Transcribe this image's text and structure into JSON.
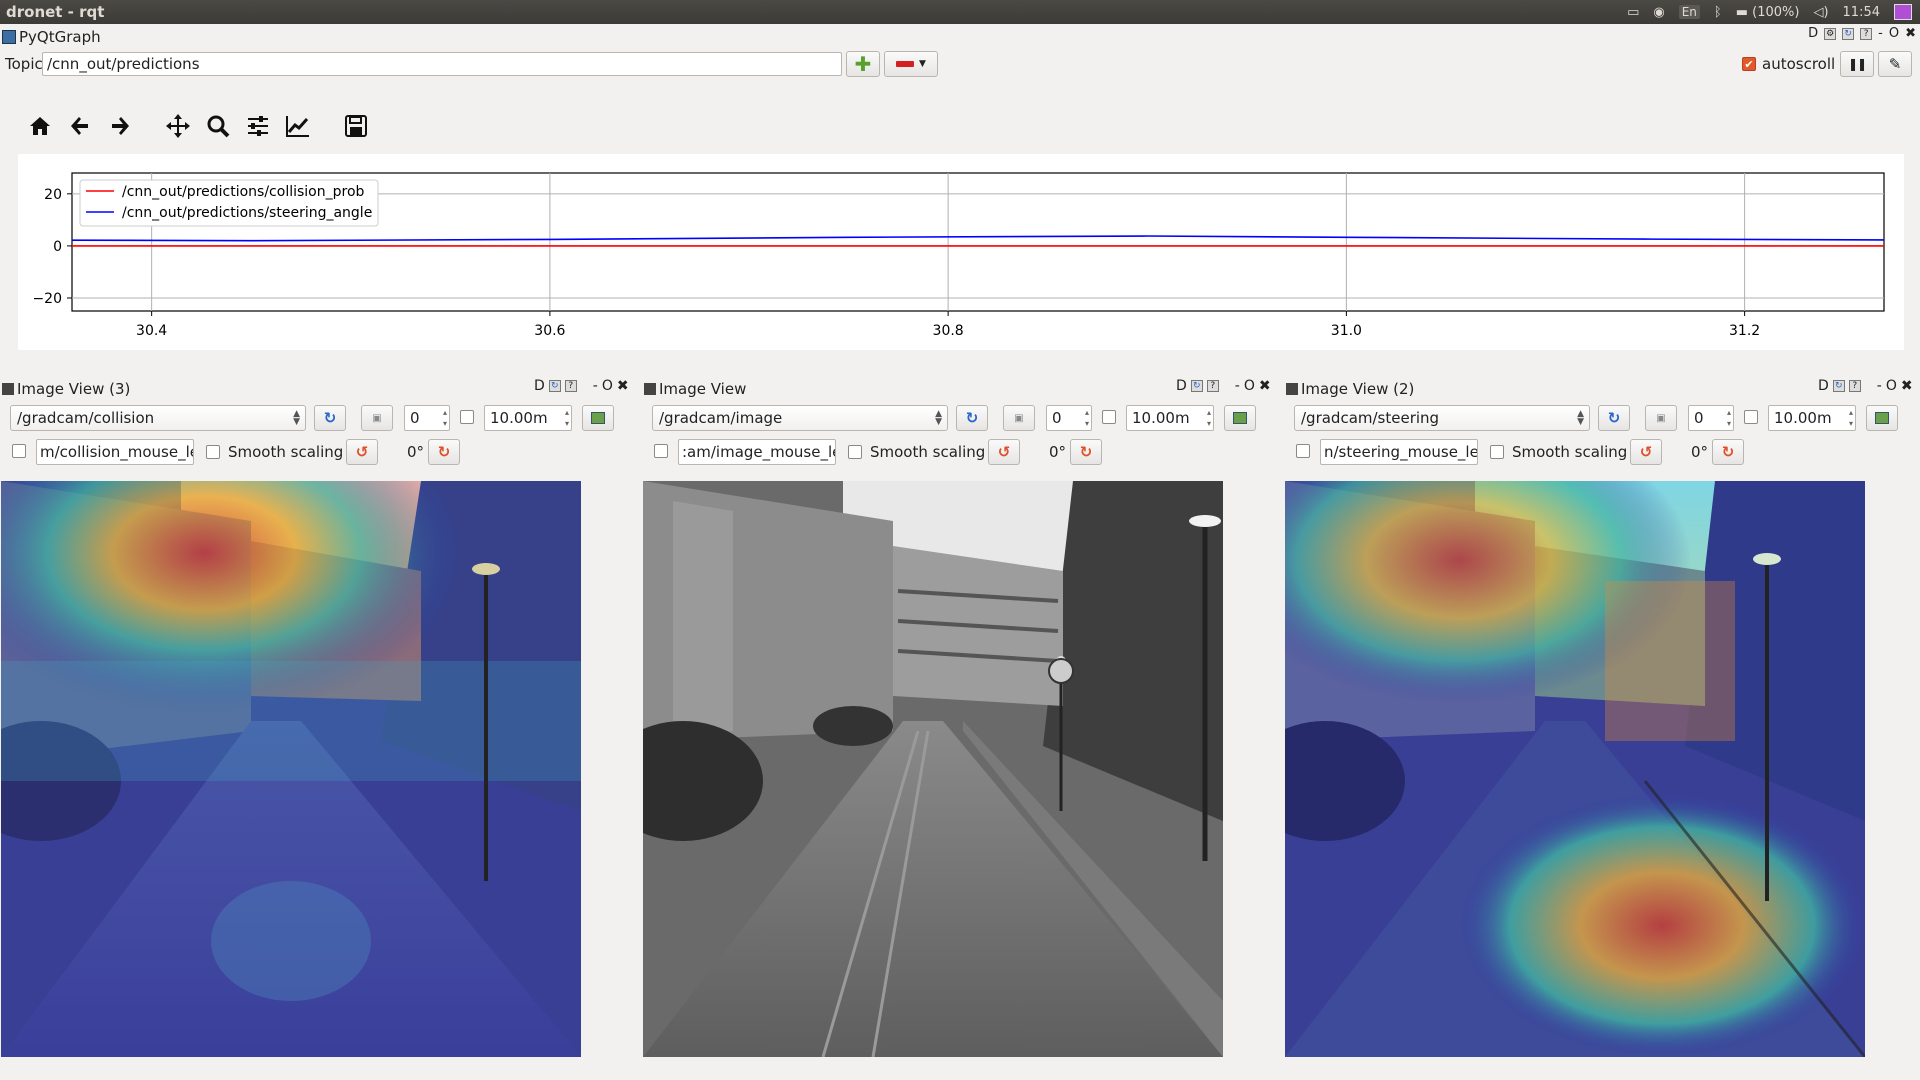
{
  "system_bar": {
    "title": "dronet - rqt",
    "lang": "En",
    "battery": "(100%)",
    "time": "11:54"
  },
  "plugin": {
    "title": "PyQtGraph",
    "ctrl_d": "D",
    "ctrl_dash": "-",
    "ctrl_o": "O",
    "ctrl_x": "✖"
  },
  "topic": {
    "label": "Topic",
    "value": "/cnn_out/predictions",
    "autoscroll_label": "autoscroll",
    "autoscroll_checked": true
  },
  "toolbar": {
    "icons": [
      "home-icon",
      "back-arrow-icon",
      "forward-arrow-icon",
      "pan-icon",
      "zoom-icon",
      "configure-subplots-icon",
      "edit-axis-icon",
      "save-icon"
    ]
  },
  "chart_data": {
    "type": "line",
    "x": [
      30.36,
      30.45,
      30.6,
      30.75,
      30.9,
      31.0,
      31.15,
      31.27
    ],
    "series": [
      {
        "name": "/cnn_out/predictions/collision_prob",
        "color": "#ff0000",
        "values": [
          0.0,
          0.0,
          0.0,
          0.0,
          0.0,
          0.0,
          0.0,
          0.0
        ]
      },
      {
        "name": "/cnn_out/predictions/steering_angle",
        "color": "#0000ff",
        "values": [
          2.2,
          2.0,
          2.5,
          3.3,
          3.8,
          3.3,
          2.6,
          2.3
        ]
      }
    ],
    "xlim": [
      30.36,
      31.27
    ],
    "ylim": [
      -25,
      28
    ],
    "xticks": [
      "30.4",
      "30.6",
      "30.8",
      "31.0",
      "31.2"
    ],
    "yticks": [
      "20",
      "0",
      "−20"
    ],
    "xtick_values": [
      30.4,
      30.6,
      30.8,
      31.0,
      31.2
    ],
    "ytick_values": [
      20,
      0,
      -20
    ],
    "grid": true,
    "legend": "top-left"
  },
  "panes": [
    {
      "title": "Image View (3)",
      "topic": "/gradcam/collision",
      "spin": "0",
      "time": "10.00m",
      "mouse_topic": "m/collision_mouse_left",
      "smooth_label": "Smooth scaling",
      "rotation": "0°",
      "overlay": "collision"
    },
    {
      "title": "Image View",
      "topic": "/gradcam/image",
      "spin": "0",
      "time": "10.00m",
      "mouse_topic": ":am/image_mouse_left",
      "smooth_label": "Smooth scaling",
      "rotation": "0°",
      "overlay": "none"
    },
    {
      "title": "Image View (2)",
      "topic": "/gradcam/steering",
      "spin": "0",
      "time": "10.00m",
      "mouse_topic": "n/steering_mouse_left",
      "smooth_label": "Smooth scaling",
      "rotation": "0°",
      "overlay": "steering"
    }
  ]
}
